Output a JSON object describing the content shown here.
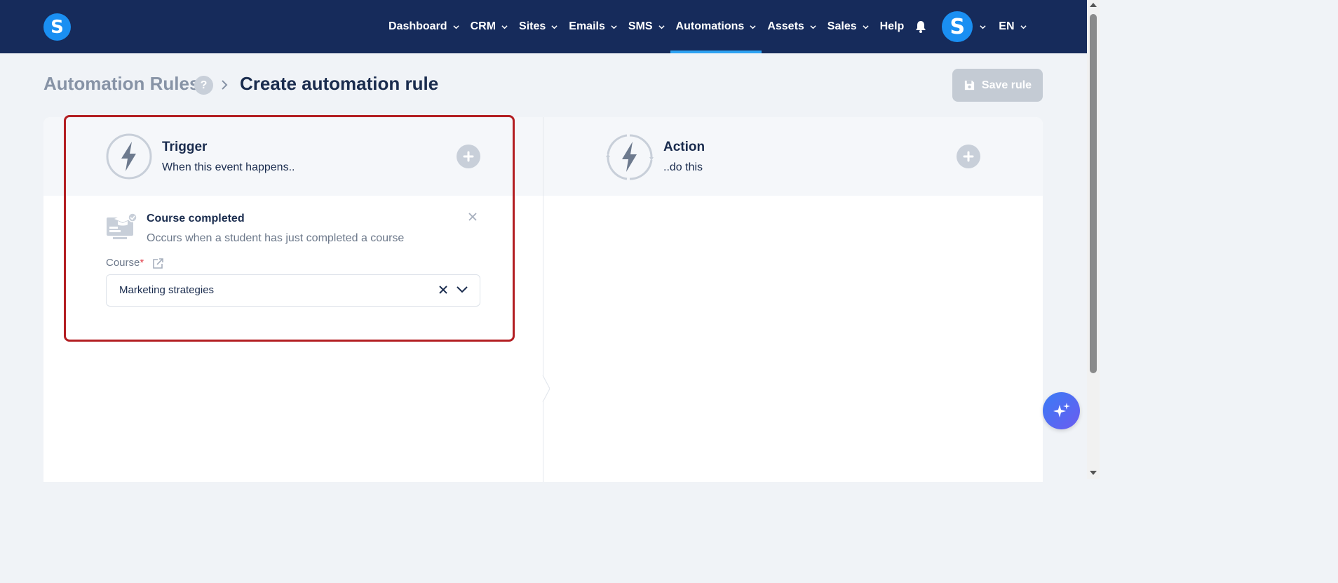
{
  "nav": {
    "items": [
      {
        "label": "Dashboard",
        "has_menu": true,
        "active": false
      },
      {
        "label": "CRM",
        "has_menu": true,
        "active": false
      },
      {
        "label": "Sites",
        "has_menu": true,
        "active": false
      },
      {
        "label": "Emails",
        "has_menu": true,
        "active": false
      },
      {
        "label": "SMS",
        "has_menu": true,
        "active": false
      },
      {
        "label": "Automations",
        "has_menu": true,
        "active": true
      },
      {
        "label": "Assets",
        "has_menu": true,
        "active": false
      },
      {
        "label": "Sales",
        "has_menu": true,
        "active": false
      },
      {
        "label": "Help",
        "has_menu": false,
        "active": false
      }
    ],
    "logo_letter": "S",
    "avatar_letter": "S",
    "language": "EN",
    "colors": {
      "bar": "#162b5b",
      "accent": "#2ea3f2",
      "logo": "#1a8ff2"
    }
  },
  "header": {
    "breadcrumb_parent": "Automation Rules",
    "help_mark": "?",
    "title": "Create automation rule",
    "save_label": "Save rule"
  },
  "trigger": {
    "title": "Trigger",
    "subtitle": "When this event happens..",
    "event": {
      "title": "Course completed",
      "description": "Occurs when a student has just completed a course"
    },
    "field": {
      "label": "Course",
      "required_mark": "*",
      "value": "Marketing strategies"
    }
  },
  "action": {
    "title": "Action",
    "subtitle": "..do this"
  },
  "highlight_color": "#b31e22"
}
